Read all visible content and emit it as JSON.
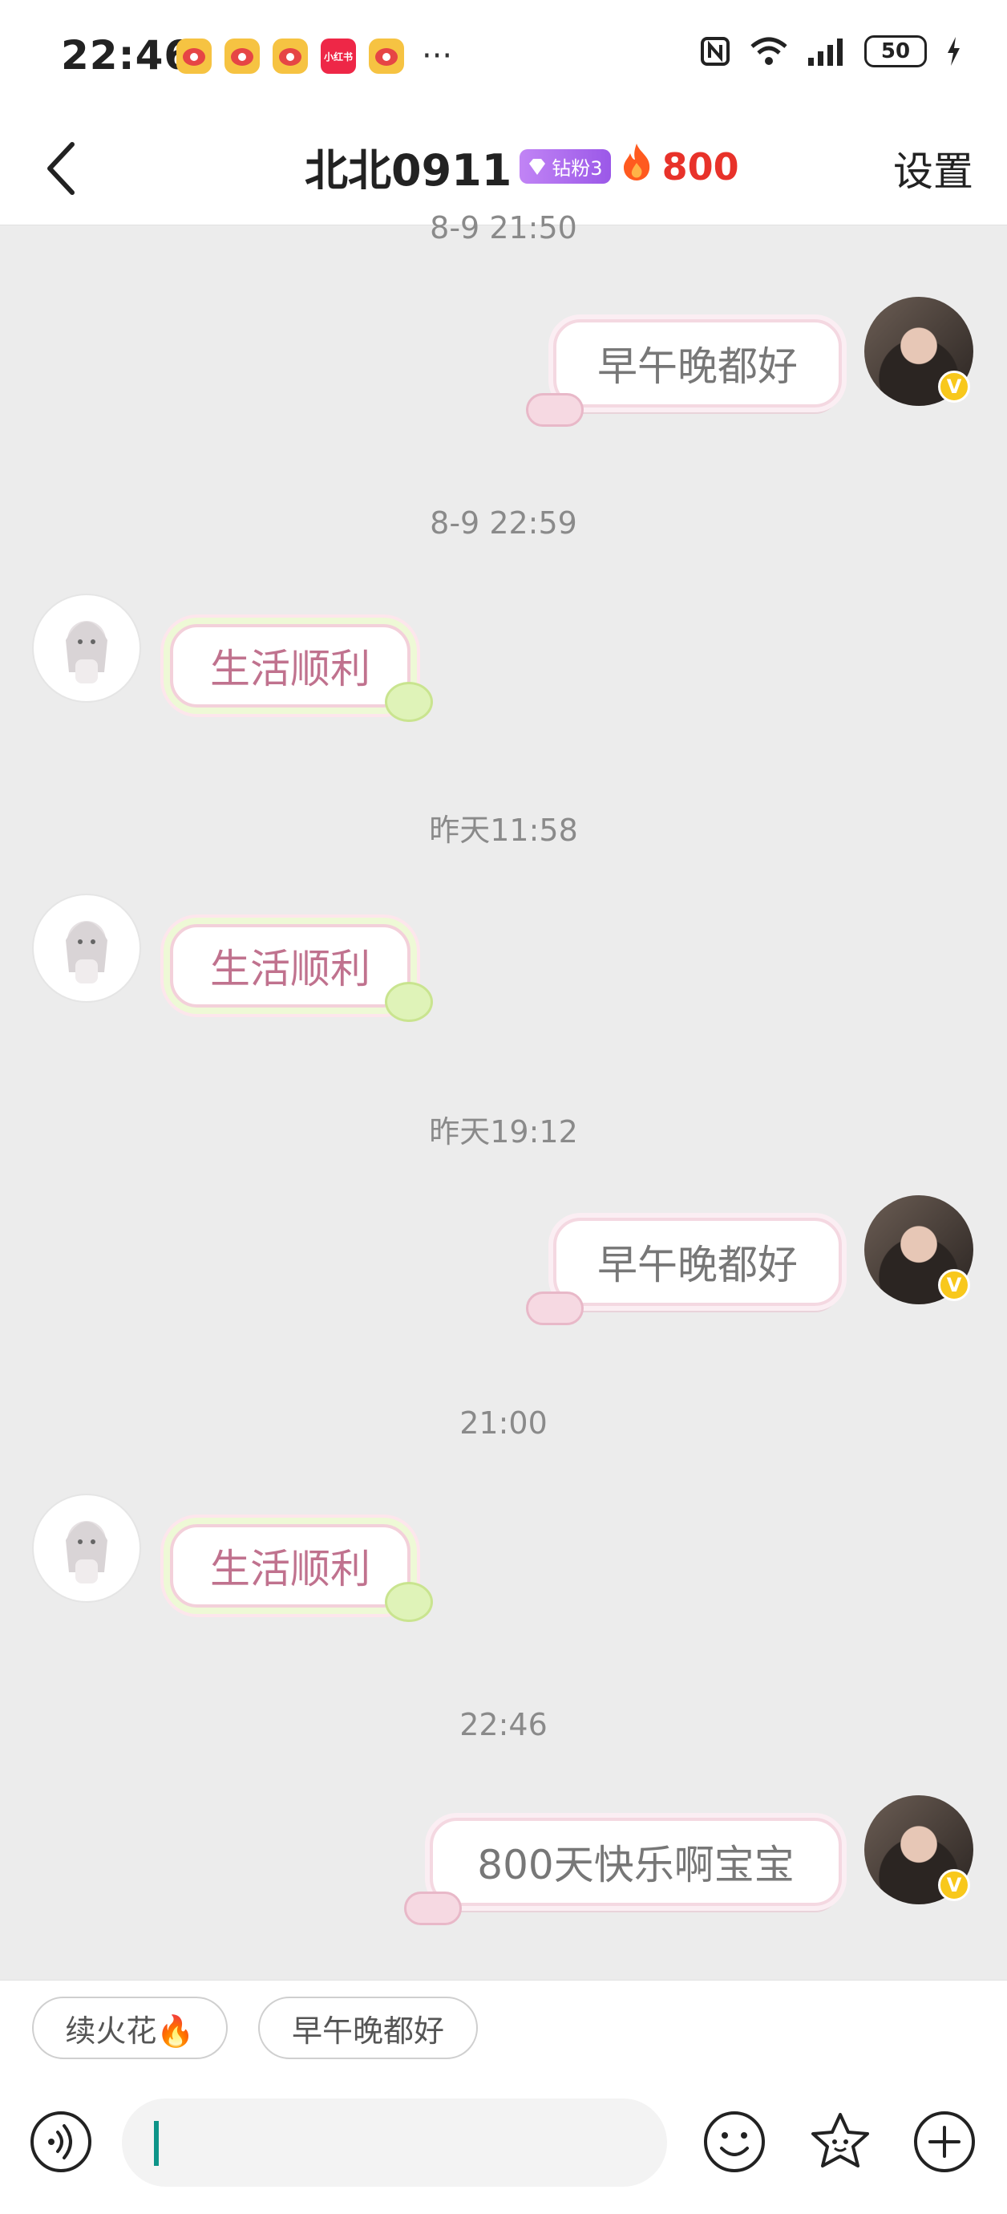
{
  "status_bar": {
    "time": "22:46",
    "apps": [
      "weibo-icon",
      "weibo-icon",
      "weibo-icon",
      "xiaohongshu-icon",
      "weibo-icon"
    ],
    "xiaohongshu_label": "小红书",
    "more": "···",
    "battery": "50"
  },
  "header": {
    "title": "北北0911",
    "fan_badge": "钻粉3",
    "spark_count": "800",
    "settings": "设置"
  },
  "messages": [
    {
      "timestamp": "8-9 21:50",
      "side": "right",
      "text": "早午晚都好"
    },
    {
      "timestamp": "8-9 22:59",
      "side": "left",
      "text": "生活顺利"
    },
    {
      "timestamp": "昨天11:58",
      "side": "left",
      "text": "生活顺利"
    },
    {
      "timestamp": "昨天19:12",
      "side": "right",
      "text": "早午晚都好"
    },
    {
      "timestamp": "21:00",
      "side": "left",
      "text": "生活顺利"
    },
    {
      "timestamp": "22:46",
      "side": "right",
      "text": "800天快乐啊宝宝"
    }
  ],
  "quick_replies": [
    "续火花🔥",
    "早午晚都好"
  ],
  "input": {
    "value": ""
  },
  "verified_badge": "V",
  "colors": {
    "accent_fire": "#e8322a",
    "fan_badge": "#a565ee",
    "caret": "#0d9488"
  }
}
